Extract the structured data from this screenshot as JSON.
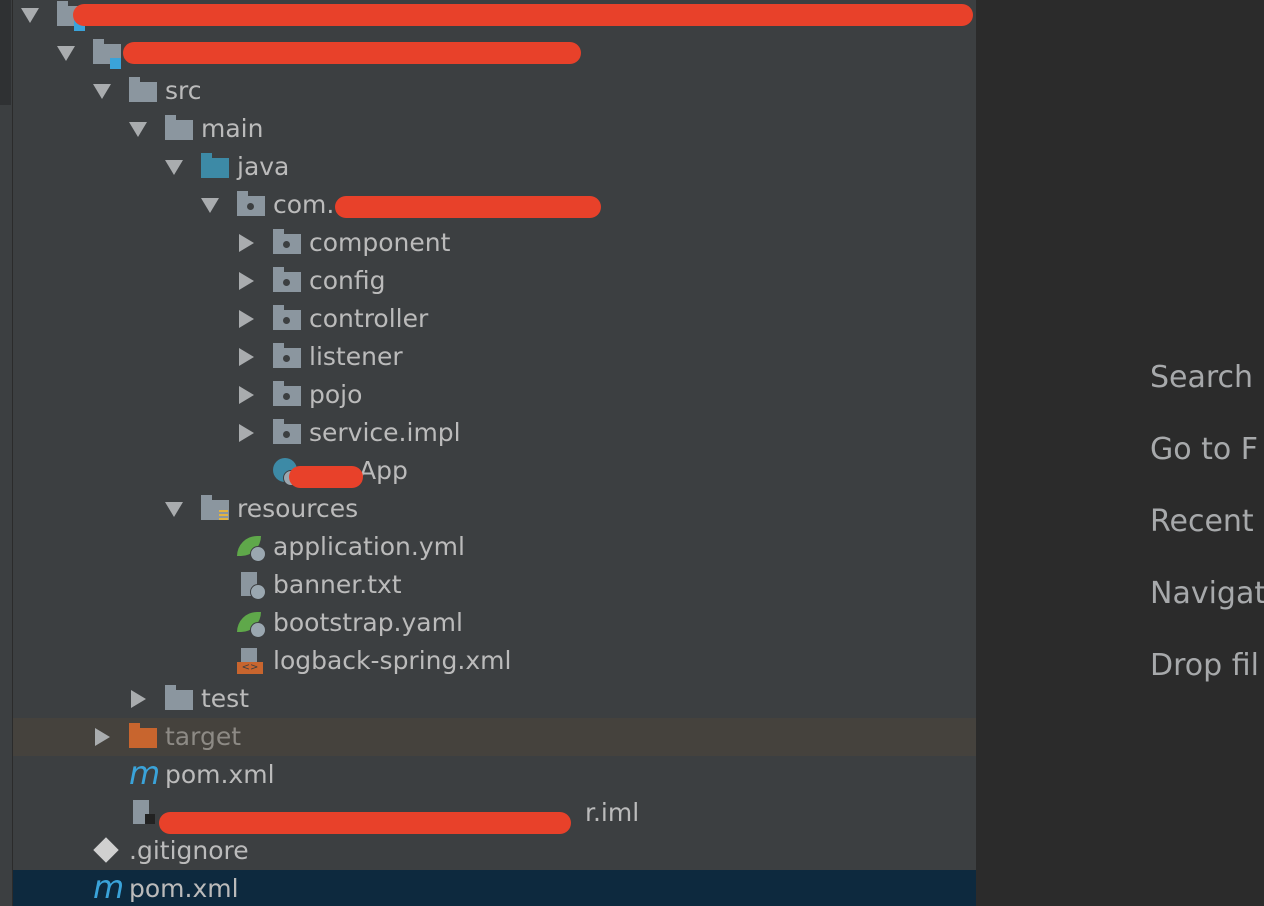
{
  "project_tree": {
    "rows": [
      {
        "label": "",
        "type": "module-root",
        "expanded": true
      },
      {
        "label": "",
        "type": "module",
        "expanded": true
      },
      {
        "label": "src",
        "type": "folder",
        "expanded": true
      },
      {
        "label": "main",
        "type": "folder",
        "expanded": true
      },
      {
        "label": "java",
        "type": "source-folder",
        "expanded": true
      },
      {
        "label": "com.",
        "type": "package",
        "expanded": true
      },
      {
        "label": "component",
        "type": "package",
        "expanded": false
      },
      {
        "label": "config",
        "type": "package",
        "expanded": false
      },
      {
        "label": "controller",
        "type": "package",
        "expanded": false
      },
      {
        "label": "listener",
        "type": "package",
        "expanded": false
      },
      {
        "label": "pojo",
        "type": "package",
        "expanded": false
      },
      {
        "label": "service.impl",
        "type": "package",
        "expanded": false
      },
      {
        "label": "App",
        "type": "spring-boot-class"
      },
      {
        "label": "resources",
        "type": "resources-folder",
        "expanded": true
      },
      {
        "label": "application.yml",
        "type": "spring-config"
      },
      {
        "label": "banner.txt",
        "type": "text-file"
      },
      {
        "label": "bootstrap.yaml",
        "type": "spring-config"
      },
      {
        "label": "logback-spring.xml",
        "type": "xml-file"
      },
      {
        "label": "test",
        "type": "folder",
        "expanded": false
      },
      {
        "label": "target",
        "type": "excluded-folder",
        "expanded": false
      },
      {
        "label": "pom.xml",
        "type": "maven-file"
      },
      {
        "label": "r.iml",
        "type": "iml-file"
      },
      {
        "label": ".gitignore",
        "type": "git-file"
      },
      {
        "label": "pom.xml",
        "type": "maven-file",
        "selected": true
      }
    ]
  },
  "editor_empty_hints": [
    "Search",
    "Go to F",
    "Recent",
    "Navigat",
    "Drop fil"
  ],
  "colors": {
    "panel": "#3c3f41",
    "editor": "#2b2b2b",
    "selection": "#0d293e",
    "excluded": "#45423d",
    "redaction": "#e8412a",
    "maven": "#3aa3d9",
    "spring": "#5fa84a",
    "target_folder": "#c8652e"
  }
}
